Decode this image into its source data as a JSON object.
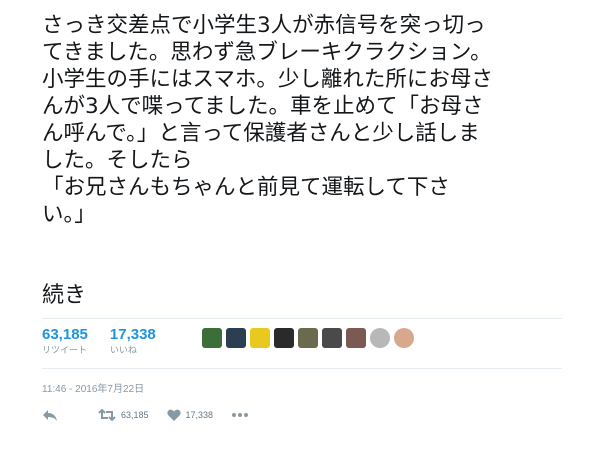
{
  "tweet": {
    "lines": [
      "さっき交差点で小学生3人が赤信号を突っ切っ",
      "てきました。思わず急ブレーキクラクション。",
      "小学生の手にはスマホ。少し離れた所にお母さ",
      "んが3人で喋ってました。車を止めて「お母さ",
      "ん呼んで。」と言って保護者さんと少し話しま",
      "した。そしたら",
      "「お兄さんもちゃんと前見て運転して下さ",
      "い。」"
    ],
    "more_link": "続き"
  },
  "stats": {
    "retweets": {
      "count": "63,185",
      "label": "リツイート"
    },
    "likes": {
      "count": "17,338",
      "label": "いいね"
    }
  },
  "likers": [
    {
      "icon": "user-avatar",
      "color": "#3c6e3a"
    },
    {
      "icon": "user-avatar",
      "color": "#2b3e52"
    },
    {
      "icon": "user-avatar",
      "color": "#e9c81f"
    },
    {
      "icon": "user-avatar",
      "color": "#2a2a2a"
    },
    {
      "icon": "user-avatar",
      "color": "#6b6a4e"
    },
    {
      "icon": "user-avatar",
      "color": "#4a4a4a"
    },
    {
      "icon": "user-avatar",
      "color": "#7a5a52"
    },
    {
      "icon": "user-avatar",
      "color": "#b8b8b8"
    },
    {
      "icon": "user-avatar",
      "color": "#d7a88b"
    }
  ],
  "timestamp": "11:46 - 2016年7月22日",
  "actions": {
    "reply_icon": "reply-icon",
    "retweet_icon": "retweet-icon",
    "retweet_count": "63,185",
    "like_icon": "heart-icon",
    "like_count": "17,338",
    "more_icon": "more-icon"
  }
}
